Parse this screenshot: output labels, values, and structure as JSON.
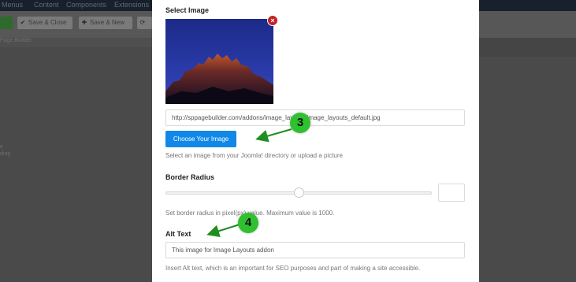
{
  "background": {
    "top_menu": [
      "Menus",
      "Content",
      "Components",
      "Extensions"
    ],
    "toolbar": {
      "save_close_label": "Save & Close",
      "save_new_label": "Save & New"
    },
    "subtitle": "Page Builder",
    "side_fragments": [
      "e",
      "ding"
    ]
  },
  "modal": {
    "select_image_label": "Select Image",
    "remove_icon": "×",
    "image_url": "http://sppagebuilder.com/addons/image_layouts/image_layouts_default.jpg",
    "choose_button_label": "Choose Your Image",
    "choose_help": "Select an image from your Joomla! directory or upload a picture",
    "border_radius_label": "Border Radius",
    "border_radius_value": "",
    "border_radius_slider_fraction": 0.5,
    "border_radius_help": "Set border radius in pixel(px) value. Maximum value is 1000.",
    "alt_text_label": "Alt Text",
    "alt_text_value": "This image for Image Layouts addon",
    "alt_text_help": "Insert Alt text, which is an important for SEO purposes and part of making a site accessible."
  },
  "annotations": {
    "callout_3": "3",
    "callout_4": "4",
    "color": "#2fc12f"
  }
}
